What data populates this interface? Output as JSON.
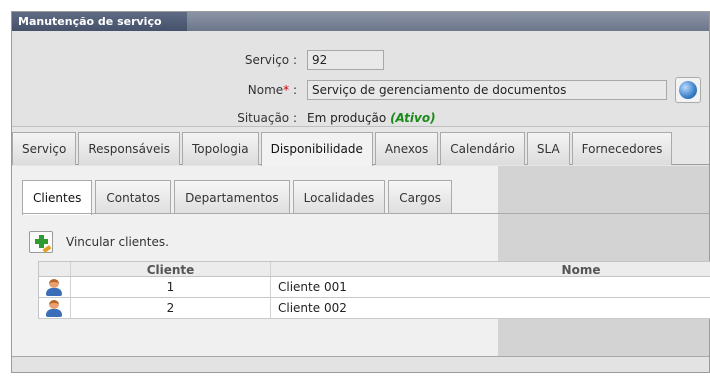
{
  "panel": {
    "title": "Manutenção de serviço"
  },
  "form": {
    "service_label": "Serviço :",
    "service_value": "92",
    "name_label": "Nome",
    "name_required": "*",
    "name_colon": " :",
    "name_value": "Serviço de gerenciamento de documentos",
    "status_label": "Situação :",
    "status_value": "Em produção",
    "status_active": "(Ativo)"
  },
  "main_tabs": [
    {
      "label": "Serviço"
    },
    {
      "label": "Responsáveis"
    },
    {
      "label": "Topologia"
    },
    {
      "label": "Disponibilidade",
      "active": true
    },
    {
      "label": "Anexos"
    },
    {
      "label": "Calendário"
    },
    {
      "label": "SLA"
    },
    {
      "label": "Fornecedores"
    }
  ],
  "sub_tabs": [
    {
      "label": "Clientes",
      "active": true
    },
    {
      "label": "Contatos"
    },
    {
      "label": "Departamentos"
    },
    {
      "label": "Localidades"
    },
    {
      "label": "Cargos"
    }
  ],
  "link": {
    "label": "Vincular clientes."
  },
  "grid": {
    "columns": [
      "Cliente",
      "Nome"
    ],
    "rows": [
      {
        "id": "1",
        "name": "Cliente 001"
      },
      {
        "id": "2",
        "name": "Cliente 002"
      }
    ]
  },
  "icons": {
    "globe": "globe-icon",
    "add": "add-client-icon",
    "user": "user-icon"
  }
}
